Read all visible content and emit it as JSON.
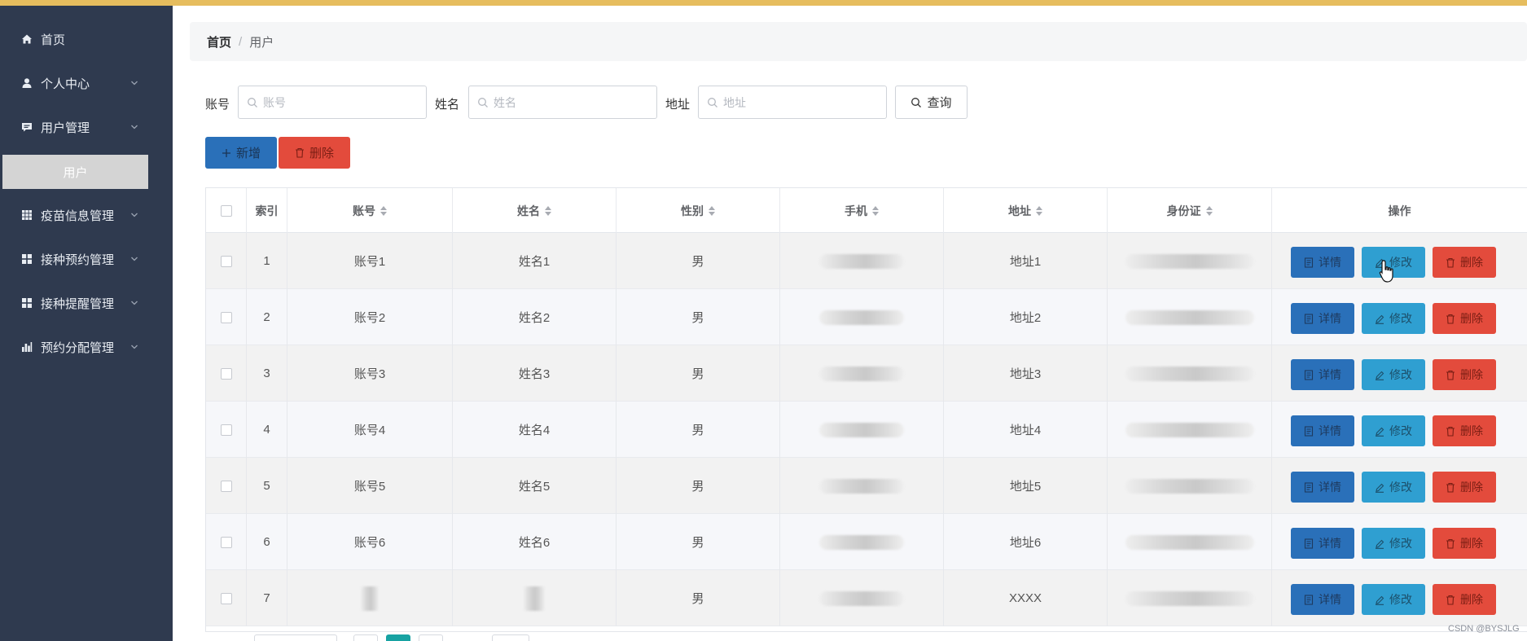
{
  "sidebar": {
    "items": [
      {
        "label": "首页",
        "icon": "home-icon"
      },
      {
        "label": "个人中心",
        "icon": "user-icon"
      },
      {
        "label": "用户管理",
        "icon": "chat-icon"
      },
      {
        "label": "疫苗信息管理",
        "icon": "grid-icon"
      },
      {
        "label": "接种预约管理",
        "icon": "grid-icon"
      },
      {
        "label": "接种提醒管理",
        "icon": "grid-icon"
      },
      {
        "label": "预约分配管理",
        "icon": "bar-chart-icon"
      }
    ],
    "subitem": "用户"
  },
  "breadcrumb": {
    "home": "首页",
    "separator": "/",
    "current": "用户"
  },
  "search": {
    "account_label": "账号",
    "account_placeholder": "账号",
    "name_label": "姓名",
    "name_placeholder": "姓名",
    "address_label": "地址",
    "address_placeholder": "地址",
    "query_label": "查询"
  },
  "actions": {
    "add_label": "新增",
    "delete_label": "删除"
  },
  "table": {
    "columns": [
      "索引",
      "账号",
      "姓名",
      "性别",
      "手机",
      "地址",
      "身份证",
      "操作"
    ],
    "rows": [
      {
        "index": "1",
        "account": "账号1",
        "name": "姓名1",
        "gender": "男",
        "address": "地址1"
      },
      {
        "index": "2",
        "account": "账号2",
        "name": "姓名2",
        "gender": "男",
        "address": "地址2"
      },
      {
        "index": "3",
        "account": "账号3",
        "name": "姓名3",
        "gender": "男",
        "address": "地址3"
      },
      {
        "index": "4",
        "account": "账号4",
        "name": "姓名4",
        "gender": "男",
        "address": "地址4"
      },
      {
        "index": "5",
        "account": "账号5",
        "name": "姓名5",
        "gender": "男",
        "address": "地址5"
      },
      {
        "index": "6",
        "account": "账号6",
        "name": "姓名6",
        "gender": "男",
        "address": "地址6"
      },
      {
        "index": "7",
        "account": "",
        "name": "",
        "gender": "男",
        "address": "XXXX"
      }
    ],
    "row_buttons": {
      "detail": "详情",
      "edit": "修改",
      "delete": "删除"
    }
  },
  "watermark": "CSDN @BYSJLG",
  "colors": {
    "sidebar": "#2f3a4f",
    "topbar": "#e6bd5e",
    "primary": "#2a70b9",
    "info": "#2f9fd1",
    "danger": "#e34b3c",
    "pager_active": "#17a2a2"
  }
}
